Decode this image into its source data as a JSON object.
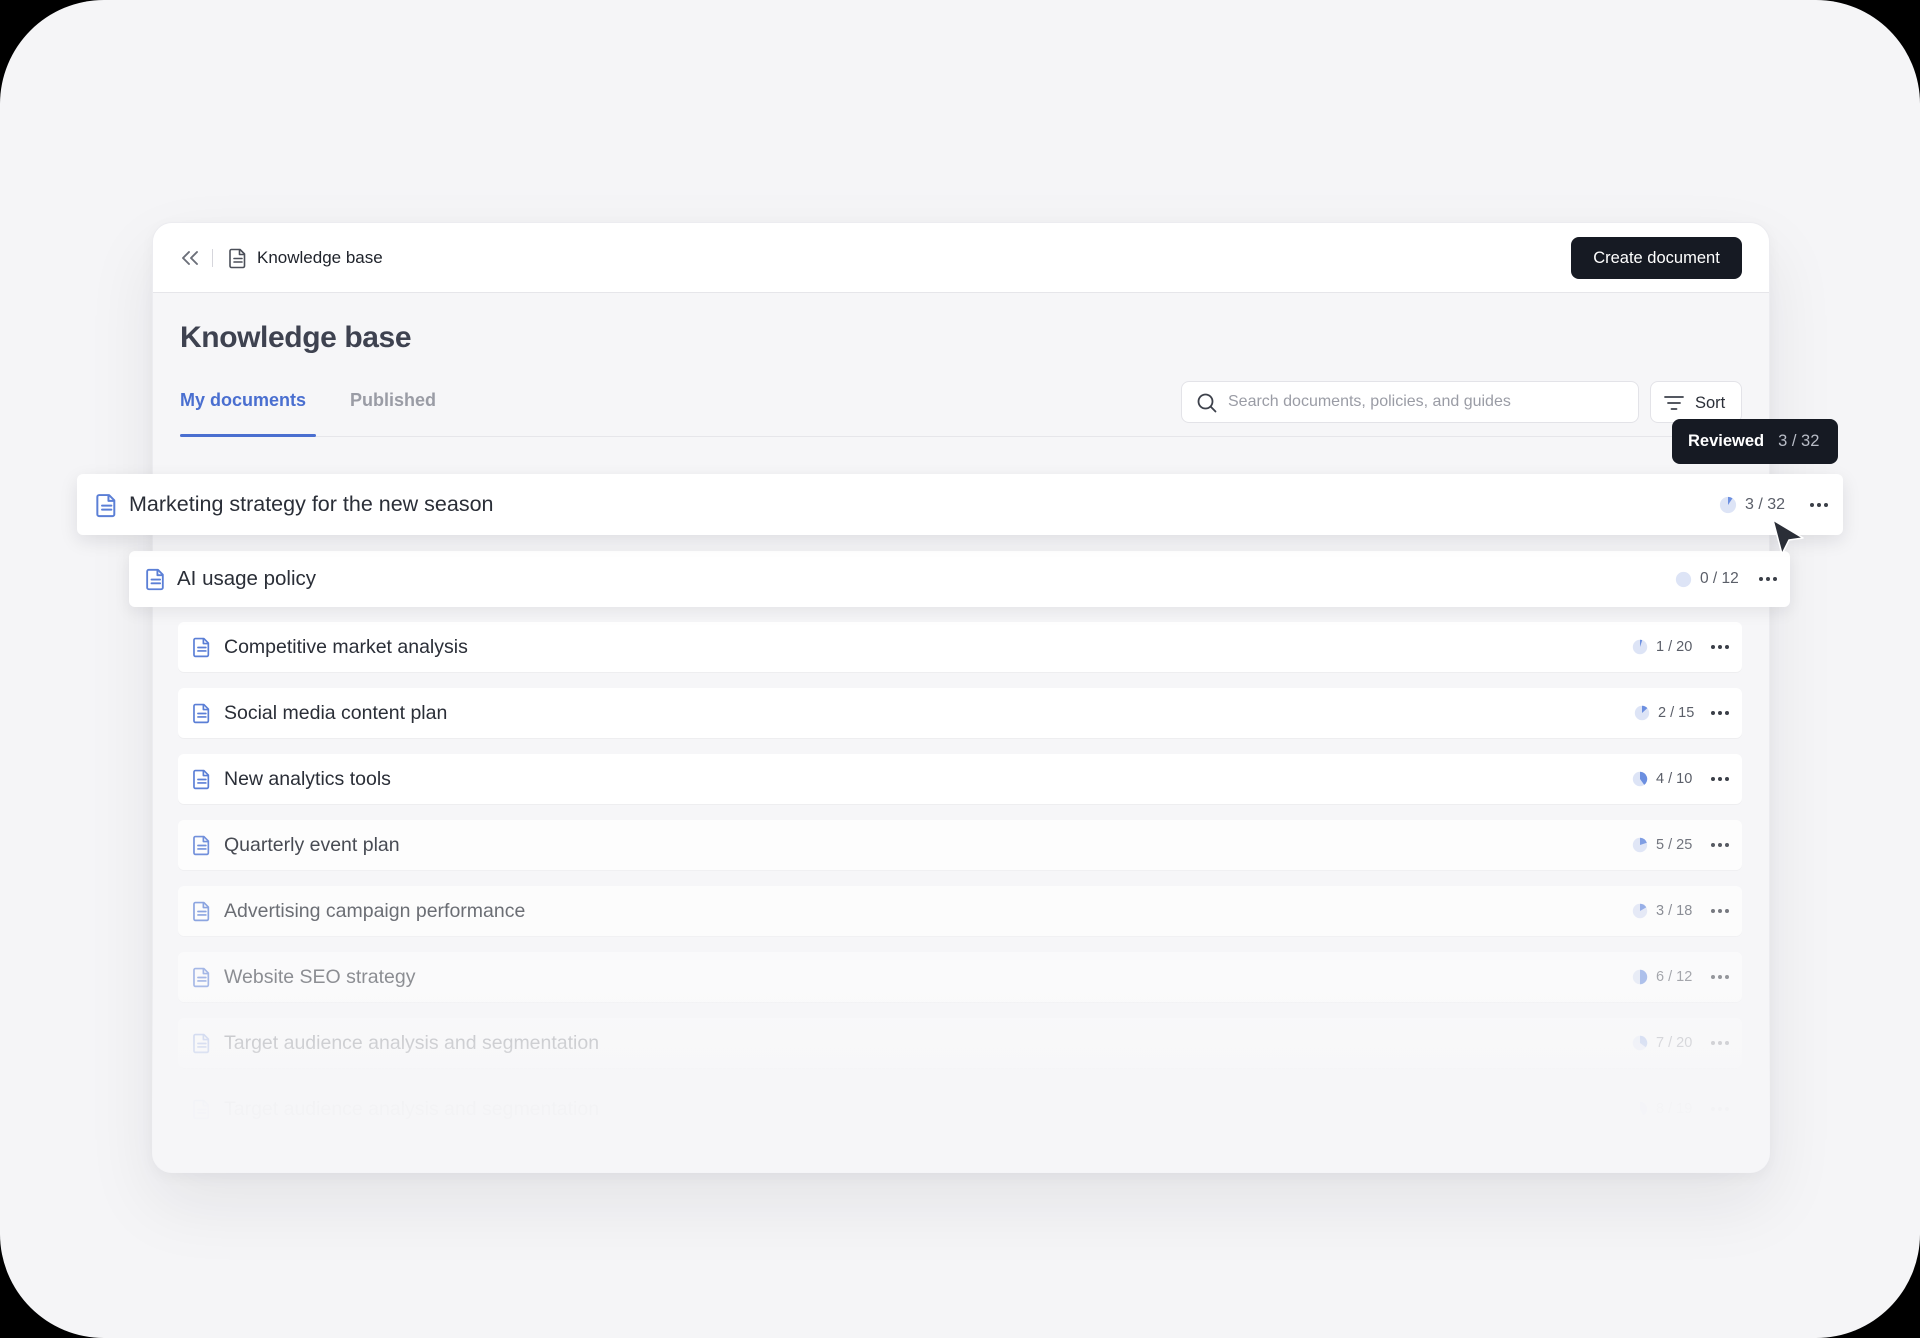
{
  "topbar": {
    "breadcrumb_label": "Knowledge base",
    "create_button_label": "Create document"
  },
  "page": {
    "title": "Knowledge base"
  },
  "tabs": [
    {
      "label": "My documents",
      "active": true
    },
    {
      "label": "Published",
      "active": false
    }
  ],
  "search": {
    "placeholder": "Search documents, policies, and guides",
    "value": ""
  },
  "sort": {
    "label": "Sort"
  },
  "tooltip": {
    "title": "Reviewed",
    "value": "3 / 32"
  },
  "documents": [
    {
      "title": "Marketing strategy for the new season",
      "progress": "3 / 32",
      "reviewed": 3,
      "total": 32
    },
    {
      "title": "AI usage policy",
      "progress": "0 / 12",
      "reviewed": 0,
      "total": 12
    },
    {
      "title": "Competitive market analysis",
      "progress": "1 / 20",
      "reviewed": 1,
      "total": 20
    },
    {
      "title": "Social media content plan",
      "progress": "2 / 15",
      "reviewed": 2,
      "total": 15
    },
    {
      "title": "New analytics tools",
      "progress": "4 / 10",
      "reviewed": 4,
      "total": 10
    },
    {
      "title": "Quarterly event plan",
      "progress": "5 / 25",
      "reviewed": 5,
      "total": 25
    },
    {
      "title": "Advertising campaign performance",
      "progress": "3 / 18",
      "reviewed": 3,
      "total": 18
    },
    {
      "title": "Website SEO strategy",
      "progress": "6 / 12",
      "reviewed": 6,
      "total": 12
    },
    {
      "title": "Target audience analysis and segmentation",
      "progress": "7 / 20",
      "reviewed": 7,
      "total": 20
    },
    {
      "title": "Target audience analysis and segmentation",
      "progress": "8 / 19",
      "reviewed": 8,
      "total": 19
    }
  ],
  "icons": {
    "collapse": "chevrons-left-icon",
    "breadcrumb": "document-icon",
    "search": "search-icon",
    "sort": "filter-lines-icon",
    "row": "document-icon",
    "more": "more-horizontal-icon",
    "cursor": "mouse-pointer-icon"
  },
  "colors": {
    "accent": "#4a6fd0",
    "dark": "#161a23",
    "doc_icon": "#5b7fd6",
    "pie_track": "#dde4f6",
    "pie_fill": "#6c8fe0"
  }
}
